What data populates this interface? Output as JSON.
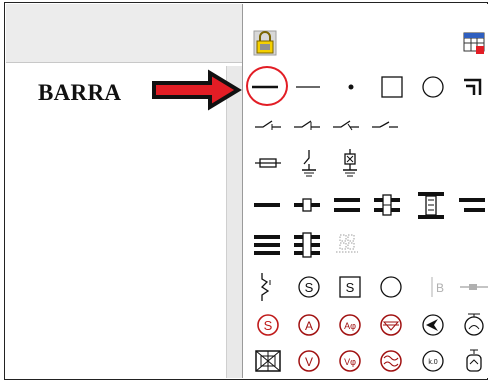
{
  "annotation": {
    "label": "BARRA",
    "arrow_color": "#e21d25",
    "highlight_color": "#e21d25"
  },
  "palette": {
    "header_icons": [
      "lock-icon",
      "table-grid-icon"
    ],
    "rows": [
      [
        "bus-bar-thick",
        "line-thin",
        "dot",
        "square",
        "circle",
        "corner-bracket"
      ],
      [
        "switch-open-1",
        "switch-open-2",
        "switch-open-3",
        "switch-open-4"
      ],
      [
        "fuse",
        "ground-switch",
        "ground-breaker"
      ],
      [
        "bar-thick",
        "bar-node",
        "double-bar",
        "double-bar-node",
        "vertical-node",
        "tee-bar"
      ],
      [
        "triple-bar",
        "triple-bar-node",
        "dotted-grid"
      ],
      [
        "wavy-switch",
        "circled-s",
        "boxed-s",
        "circle-open",
        "gray-b",
        "gray-line"
      ],
      [
        "circled-s-red",
        "circled-a",
        "circled-a-phi",
        "circled-delta-v",
        "circled-arrow",
        "circled-meter"
      ],
      [
        "boxed-cross",
        "circled-v",
        "circled-v-phi",
        "circled-ac",
        "circled-kvar",
        "meter-chip"
      ]
    ],
    "text": {
      "boxed_s": "S",
      "circled_s": "S",
      "gray_b": "B",
      "circled_a": "A",
      "circled_a_phi": "Aφ",
      "circled_v": "V",
      "circled_v_phi": "Vφ",
      "circled_kvar": "k.0"
    }
  }
}
